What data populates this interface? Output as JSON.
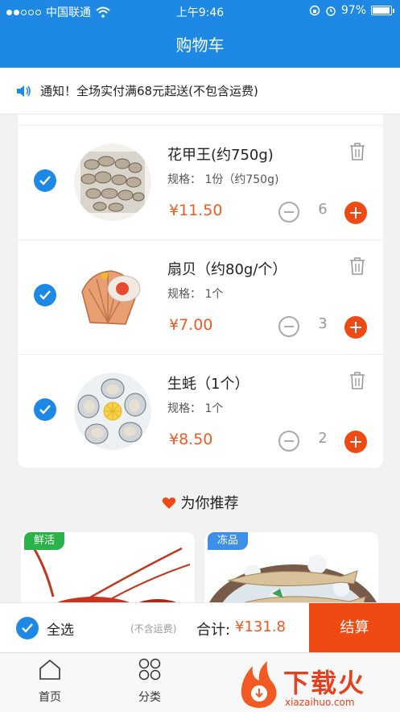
{
  "status": {
    "carrier": "中国联通",
    "time": "上午9:46",
    "battery": "97%"
  },
  "header": {
    "title": "购物车"
  },
  "notice": {
    "text": "通知！全场实付满68元起送(不包含运费)"
  },
  "cart": {
    "items": [
      {
        "name": "花甲王(约750g)",
        "spec_label": "规格：",
        "spec": "1份（约750g)",
        "price": "¥11.50",
        "qty": "6",
        "checked": true
      },
      {
        "name": "扇贝（约80g/个）",
        "spec_label": "规格：",
        "spec": "1个",
        "price": "¥7.00",
        "qty": "3",
        "checked": true
      },
      {
        "name": "生蚝（1个）",
        "spec_label": "规格：",
        "spec": "1个",
        "price": "¥8.50",
        "qty": "2",
        "checked": true
      }
    ]
  },
  "recommend": {
    "title": "为你推荐",
    "cards": [
      {
        "tag": "鲜活",
        "tag_color": "#2bb34a"
      },
      {
        "tag": "冻品",
        "tag_color": "#3d8fe8"
      }
    ]
  },
  "footer": {
    "select_all": "全选",
    "shipping_note": "(不含运费)",
    "total_label": "合计:",
    "total_value": "¥131.8",
    "checkout": "结算"
  },
  "tabs": [
    {
      "label": "首页"
    },
    {
      "label": "分类"
    }
  ],
  "watermark": {
    "text": "下载火",
    "url": "xiazaihuo.com"
  },
  "colors": {
    "primary": "#1e88e5",
    "accent": "#f04a14",
    "price": "#f05a22"
  }
}
